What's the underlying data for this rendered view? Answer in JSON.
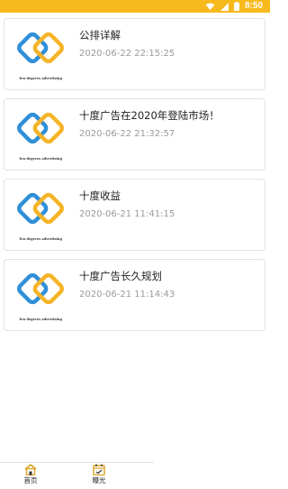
{
  "status_bar": {
    "time": "8:50",
    "icons": [
      "wifi-icon",
      "signal-icon",
      "battery-icon"
    ]
  },
  "articles": [
    {
      "title": "公排详解",
      "date": "2020-06-22 22:15:25",
      "logo_caption": "Ten degrees advertising"
    },
    {
      "title": "十度广告在2020年登陆市场！",
      "date": "2020-06-22 21:32:57",
      "logo_caption": "Ten degrees advertising"
    },
    {
      "title": "十度收益",
      "date": "2020-06-21 11:41:15",
      "logo_caption": "Ten degrees advertising"
    },
    {
      "title": "十度广告长久规划",
      "date": "2020-06-21 11:14:43",
      "logo_caption": "Ten degrees advertising"
    }
  ],
  "tabbar": {
    "tabs": [
      {
        "label": "首页",
        "icon": "home-icon"
      },
      {
        "label": "曝光",
        "icon": "calendar-icon"
      }
    ]
  },
  "colors": {
    "status_bar": "#f8b91c",
    "logo_blue": "#2f8fd8",
    "logo_yellow": "#f5b427",
    "tab_icon": "#d9a21e"
  }
}
